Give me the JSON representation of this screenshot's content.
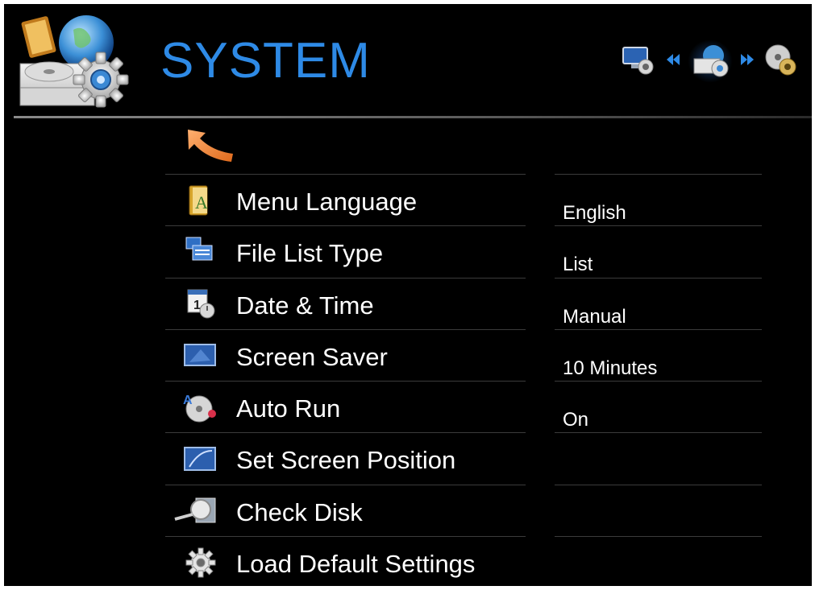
{
  "header": {
    "title": "SYSTEM",
    "logo_icon": "system-settings-icon",
    "nav": {
      "prev_icon": "display-settings-icon",
      "current_icon": "system-icon",
      "next_icon": "disc-settings-icon",
      "prev_arrow": "rewind-arrow-icon",
      "next_arrow": "fast-forward-arrow-icon"
    }
  },
  "back": {
    "icon": "back-arrow-icon"
  },
  "menu": {
    "items": [
      {
        "label": "Menu Language",
        "icon": "language-book-icon",
        "value": "English"
      },
      {
        "label": "File List Type",
        "icon": "file-list-icon",
        "value": "List"
      },
      {
        "label": "Date & Time",
        "icon": "calendar-clock-icon",
        "value": "Manual"
      },
      {
        "label": "Screen Saver",
        "icon": "screen-saver-icon",
        "value": "10 Minutes"
      },
      {
        "label": "Auto Run",
        "icon": "auto-run-disc-icon",
        "value": "On"
      },
      {
        "label": "Set Screen Position",
        "icon": "screen-position-icon",
        "value": ""
      },
      {
        "label": "Check Disk",
        "icon": "magnifier-disk-icon",
        "value": ""
      },
      {
        "label": "Load Default Settings",
        "icon": "gear-icon",
        "value": ""
      }
    ]
  },
  "colors": {
    "background": "#000000",
    "title": "#2e8ae6",
    "text": "#ffffff",
    "divider": "#3b3b3b",
    "accent_arrow": "#f08a3c"
  }
}
